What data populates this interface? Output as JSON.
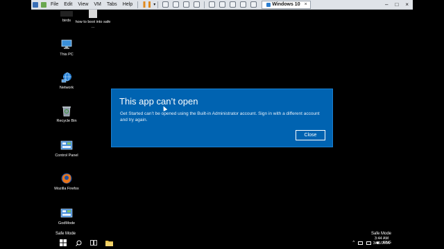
{
  "vm_toolbar": {
    "menus": [
      "File",
      "Edit",
      "View",
      "VM",
      "Tabs",
      "Help"
    ],
    "tab_label": "Windows 10",
    "tab_close": "×",
    "window_controls": [
      "–",
      "□",
      "×"
    ]
  },
  "desktop_icons": [
    {
      "label": "birds"
    },
    {
      "label": "how to boot into safe ..."
    },
    {
      "label": "This PC"
    },
    {
      "label": "Network"
    },
    {
      "label": "Recycle Bin"
    },
    {
      "label": "Control Panel"
    },
    {
      "label": "Mozilla Firefox"
    },
    {
      "label": "GodMode"
    }
  ],
  "dialog": {
    "title": "This app can’t open",
    "message": "Get Started can’t be opened using the Built-in Administrator account. Sign in with a different account and try again.",
    "close_label": "Close"
  },
  "safe_mode": {
    "left": "Safe Mode",
    "right": "Safe Mode"
  },
  "taskbar": {
    "language": "ENG",
    "time": "3:44 AM",
    "date": "3/26/2016"
  },
  "colors": {
    "dialog_bg": "#0063b1",
    "desktop_bg": "#000000"
  }
}
